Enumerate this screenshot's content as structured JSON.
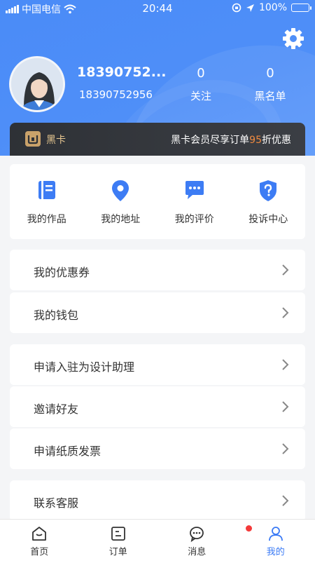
{
  "status_bar": {
    "carrier": "中国电信",
    "time": "20:44",
    "battery": "100%"
  },
  "profile": {
    "name": "18390752...",
    "phone": "18390752956",
    "following_count": "0",
    "following_label": "关注",
    "blacklist_count": "0",
    "blacklist_label": "黑名单"
  },
  "black_card": {
    "title": "黑卡",
    "promo_prefix": "黑卡会员尽享订单",
    "promo_highlight": "95",
    "promo_suffix": "折优惠"
  },
  "quick_actions": [
    {
      "label": "我的作品",
      "icon": "book-icon"
    },
    {
      "label": "我的地址",
      "icon": "location-pin-icon"
    },
    {
      "label": "我的评价",
      "icon": "chat-bubble-icon"
    },
    {
      "label": "投诉中心",
      "icon": "shield-question-icon"
    }
  ],
  "menu": {
    "coupons": "我的优惠券",
    "wallet": "我的钱包",
    "apply_assistant": "申请入驻为设计助理",
    "invite_friends": "邀请好友",
    "paper_invoice": "申请纸质发票",
    "customer_service": "联系客服"
  },
  "tabbar": [
    {
      "label": "首页",
      "icon": "home-icon"
    },
    {
      "label": "订单",
      "icon": "order-icon"
    },
    {
      "label": "消息",
      "icon": "message-icon"
    },
    {
      "label": "我的",
      "icon": "profile-icon"
    }
  ],
  "colors": {
    "primary": "#4a8bf7",
    "accent_orange": "#f08a40",
    "badge_red": "#f43a3a",
    "active_tab": "#3a7af5"
  }
}
